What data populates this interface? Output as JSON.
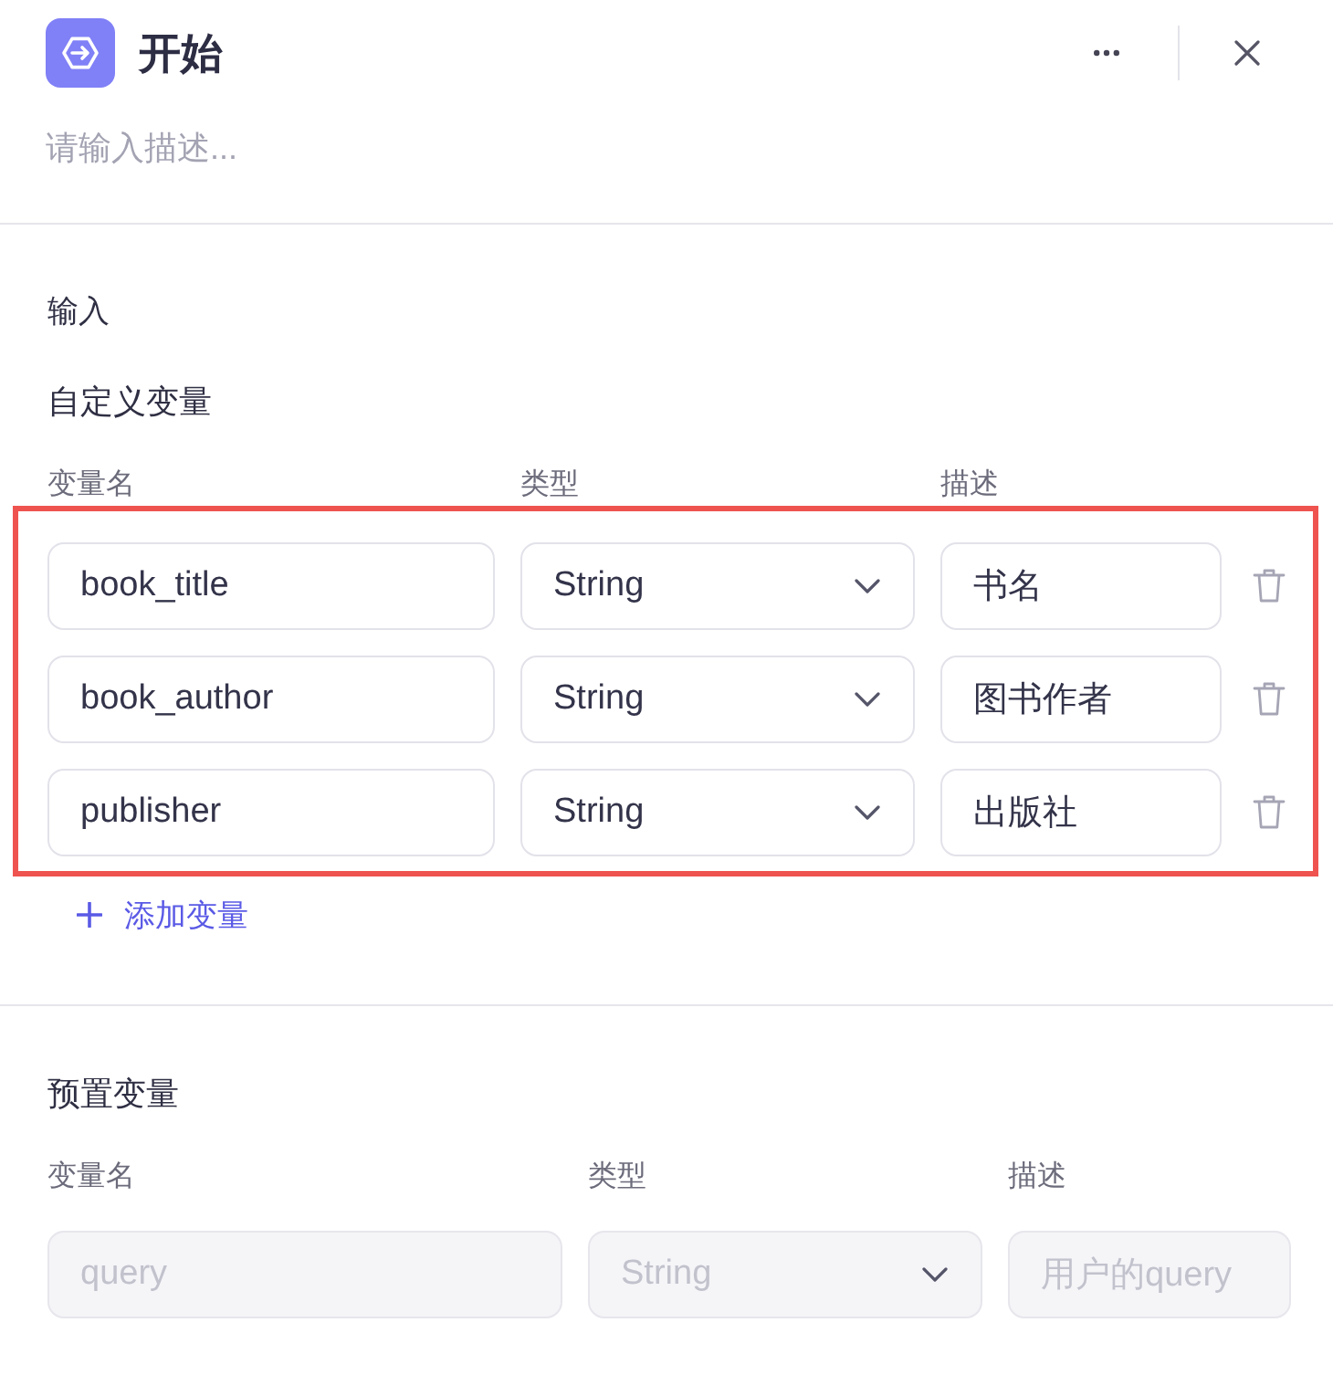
{
  "header": {
    "title": "开始",
    "description": {
      "placeholder": "请输入描述..."
    }
  },
  "input": {
    "title": "输入",
    "custom_variables": {
      "title": "自定义变量",
      "highlighted": true,
      "columns": [
        "变量名",
        "类型",
        "描述"
      ],
      "rows": [
        {
          "name": "book_title",
          "type": "String",
          "description": "书名",
          "disabled": false
        },
        {
          "name": "book_author",
          "type": "String",
          "description": "图书作者",
          "disabled": false
        },
        {
          "name": "publisher",
          "type": "String",
          "description": "出版社",
          "disabled": false
        }
      ],
      "add_button": "添加变量"
    },
    "preset_variables": {
      "title": "预置变量",
      "columns": [
        "变量名",
        "类型",
        "描述"
      ],
      "rows": [
        {
          "name": "query",
          "type": "String",
          "description": "用户的query",
          "disabled": true
        }
      ]
    }
  }
}
